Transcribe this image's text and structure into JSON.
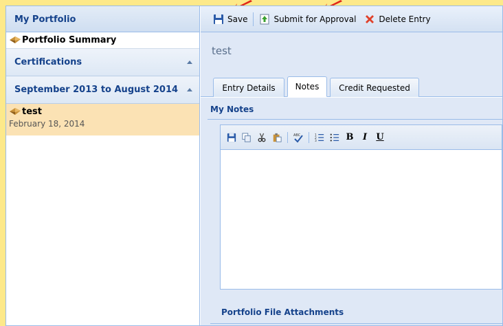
{
  "left_panel": {
    "header": "My Portfolio",
    "summary_label": "Portfolio Summary",
    "sections": [
      {
        "label": "Certifications"
      },
      {
        "label": "September 2013 to August 2014"
      }
    ],
    "entry": {
      "name": "test",
      "date": "February 18, 2014"
    }
  },
  "toolbar": {
    "save_label": "Save",
    "submit_label": "Submit for Approval",
    "delete_label": "Delete Entry"
  },
  "entry_title": "test",
  "tabs": [
    {
      "label": "Entry Details"
    },
    {
      "label": "Notes",
      "active": true
    },
    {
      "label": "Credit Requested"
    }
  ],
  "notes_section": "My Notes",
  "editor": {
    "buttons": [
      "save-icon",
      "copy-icon",
      "cut-icon",
      "paste-icon",
      "spellcheck-icon",
      "ordered-list-icon",
      "unordered-list-icon",
      "bold-icon",
      "italic-icon",
      "underline-icon"
    ],
    "bold_glyph": "B",
    "italic_glyph": "I",
    "underline_glyph": "U"
  },
  "attachments_section": "Portfolio File Attachments",
  "colors": {
    "background": "#fde98a",
    "accent": "#15428b",
    "selected_entry": "#fbe2b4",
    "arrow": "#e0261a"
  }
}
